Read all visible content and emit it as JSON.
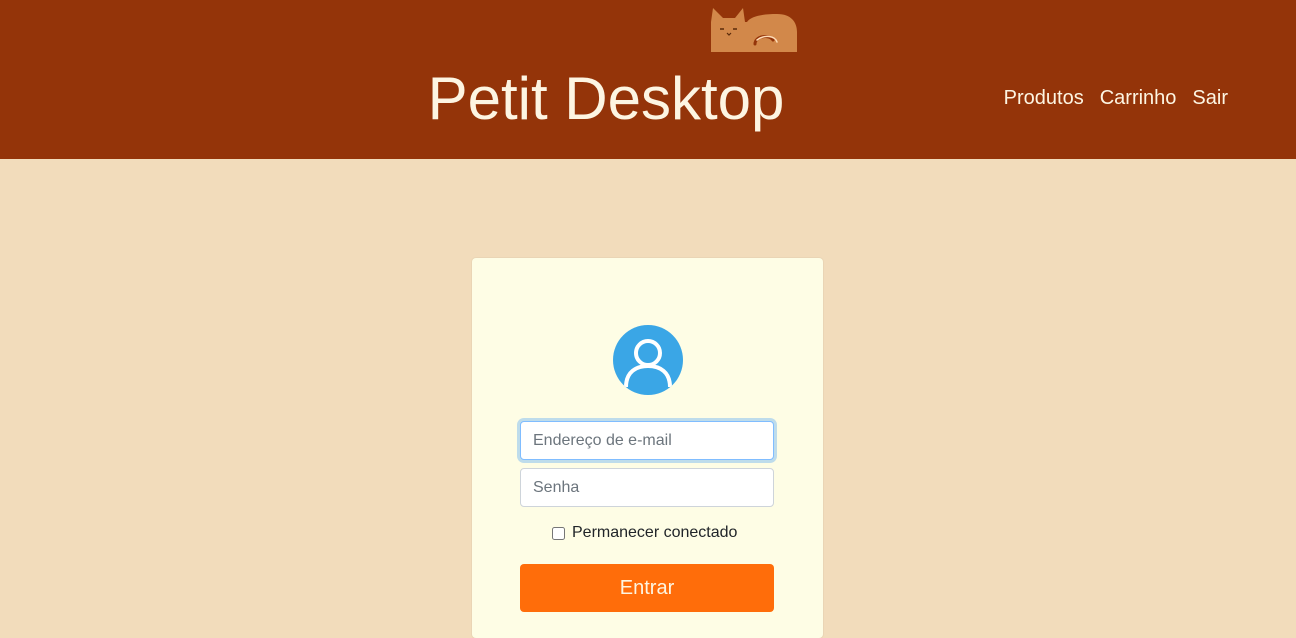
{
  "header": {
    "title": "Petit Desktop",
    "logo_icon": "sleeping-cat-logo",
    "nav": [
      {
        "label": "Produtos"
      },
      {
        "label": "Carrinho"
      },
      {
        "label": "Sair"
      }
    ]
  },
  "login": {
    "avatar_icon": "user-avatar-icon",
    "email": {
      "value": "",
      "placeholder": "Endereço de e-mail"
    },
    "password": {
      "value": "",
      "placeholder": "Senha"
    },
    "remember_label": "Permanecer conectado",
    "remember_checked": false,
    "submit_label": "Entrar"
  },
  "colors": {
    "header_bg": "#943409",
    "page_bg": "#f2dcbb",
    "card_bg": "#fefde5",
    "button_bg": "#ff6d0a",
    "avatar_bg": "#3aa6e6"
  }
}
